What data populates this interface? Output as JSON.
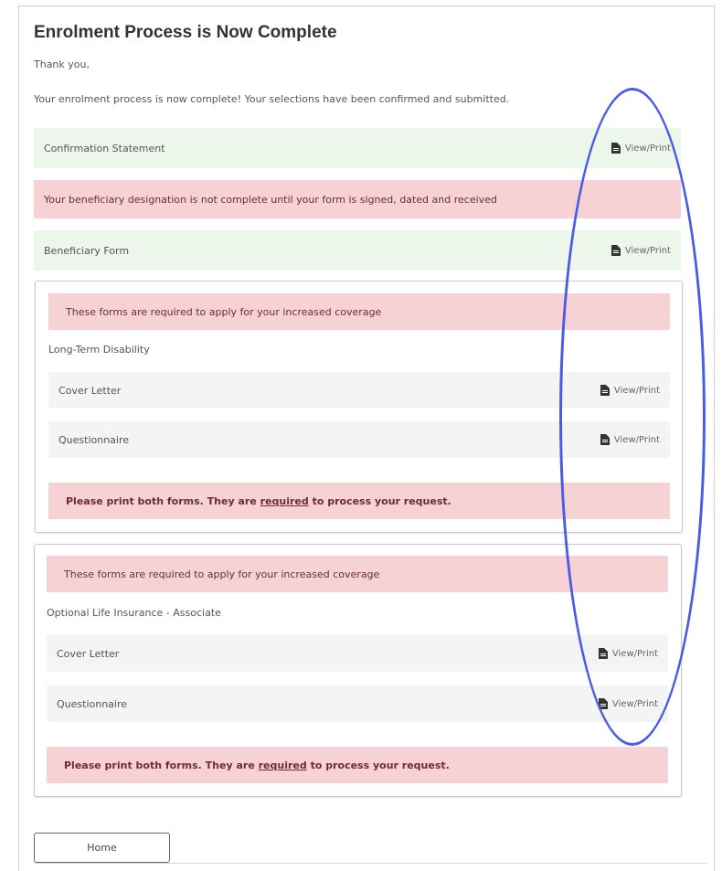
{
  "page": {
    "title": "Enrolment Process is Now Complete",
    "thank_you": "Thank you,",
    "complete_message": "Your enrolment process is now complete! Your selections have been confirmed and submitted."
  },
  "confirmation": {
    "label": "Confirmation Statement",
    "link": "View/Print"
  },
  "beneficiary_warning": "Your beneficiary designation is not complete until your form is signed, dated and received",
  "beneficiary_form": {
    "label": "Beneficiary Form",
    "link": "View/Print"
  },
  "panels": [
    {
      "notice": "These forms are required to apply for your increased coverage",
      "section": "Long-Term Disability",
      "forms": [
        {
          "label": "Cover Letter",
          "link": "View/Print"
        },
        {
          "label": "Questionnaire",
          "link": "View/Print"
        }
      ],
      "warning_prefix": "Please print both forms. They are ",
      "warning_emphasis": "required",
      "warning_suffix": " to process your request."
    },
    {
      "notice": "These forms are required to apply for your increased coverage",
      "section": "Optional Life Insurance - Associate",
      "forms": [
        {
          "label": "Cover Letter",
          "link": "View/Print"
        },
        {
          "label": "Questionnaire",
          "link": "View/Print"
        }
      ],
      "warning_prefix": "Please print both forms. They are ",
      "warning_emphasis": "required",
      "warning_suffix": " to process your request."
    }
  ],
  "home_button": "Home",
  "icons": {
    "view": "file-icon"
  },
  "colors": {
    "success_bg": "#edf6ea",
    "alert_bg": "#f6d2d5",
    "alert_text": "#6c2d34",
    "row_bg": "#f4f4f4",
    "annotation": "#4a5be6"
  }
}
